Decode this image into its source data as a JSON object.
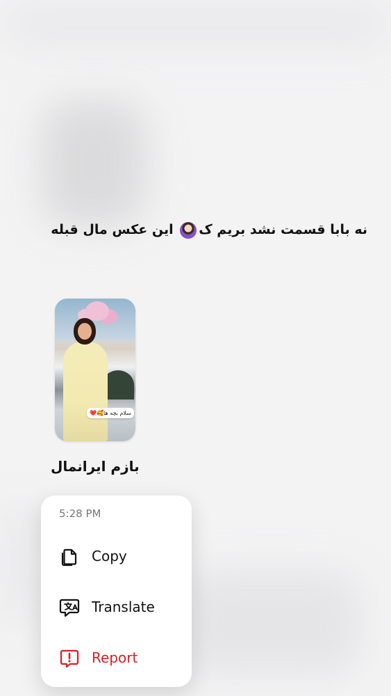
{
  "message": {
    "text_part_1": "نه بابا قسمت نشد بریم ک",
    "text_part_2": "این عکس مال قبله"
  },
  "story": {
    "sticker_text": "سلام بچه ها🥰❤️"
  },
  "caption": {
    "text": "بازم ایرانمال"
  },
  "context_menu": {
    "time": "5:28 PM",
    "items": [
      {
        "label": "Copy",
        "icon": "copy-icon"
      },
      {
        "label": "Translate",
        "icon": "translate-icon"
      },
      {
        "label": "Report",
        "icon": "report-icon",
        "color": "#d91f2a"
      }
    ]
  }
}
